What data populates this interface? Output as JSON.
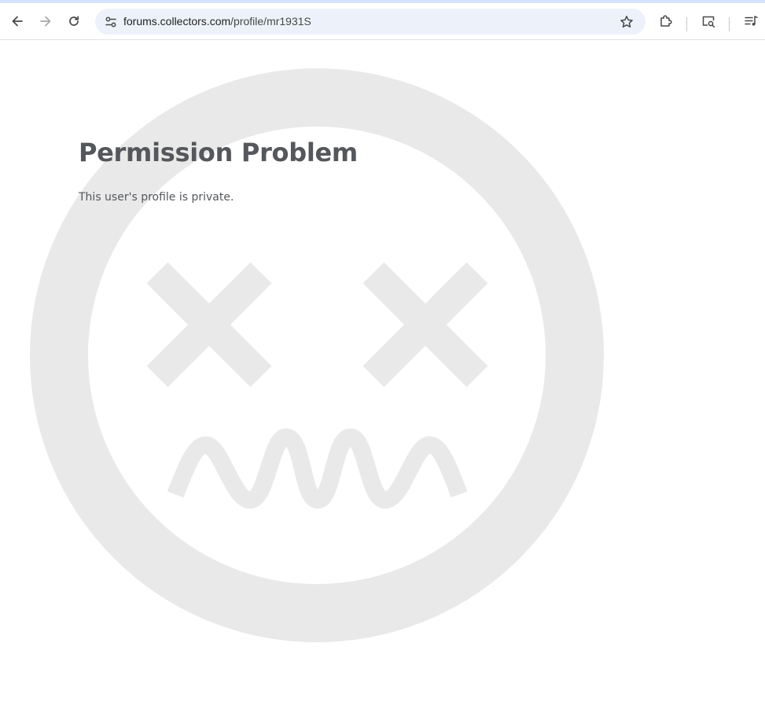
{
  "browser": {
    "url_host": "forums.collectors.com",
    "url_path": "/profile/mr1931S",
    "icons": {
      "back": "arrow-left-icon",
      "forward": "arrow-right-icon",
      "reload": "reload-icon",
      "site_info": "tune-icon",
      "bookmark": "star-icon",
      "extensions": "puzzle-icon",
      "lens": "search-screen-icon",
      "media": "queue-music-icon"
    }
  },
  "page": {
    "title": "Permission Problem",
    "message": "This user's profile is private.",
    "watermark_icon": "dizzy-face-icon",
    "colors": {
      "text": "#54575c",
      "watermark": "#e9e9e9",
      "accent_strip": "#d3e3fd",
      "omnibox": "#edf2fa"
    }
  }
}
